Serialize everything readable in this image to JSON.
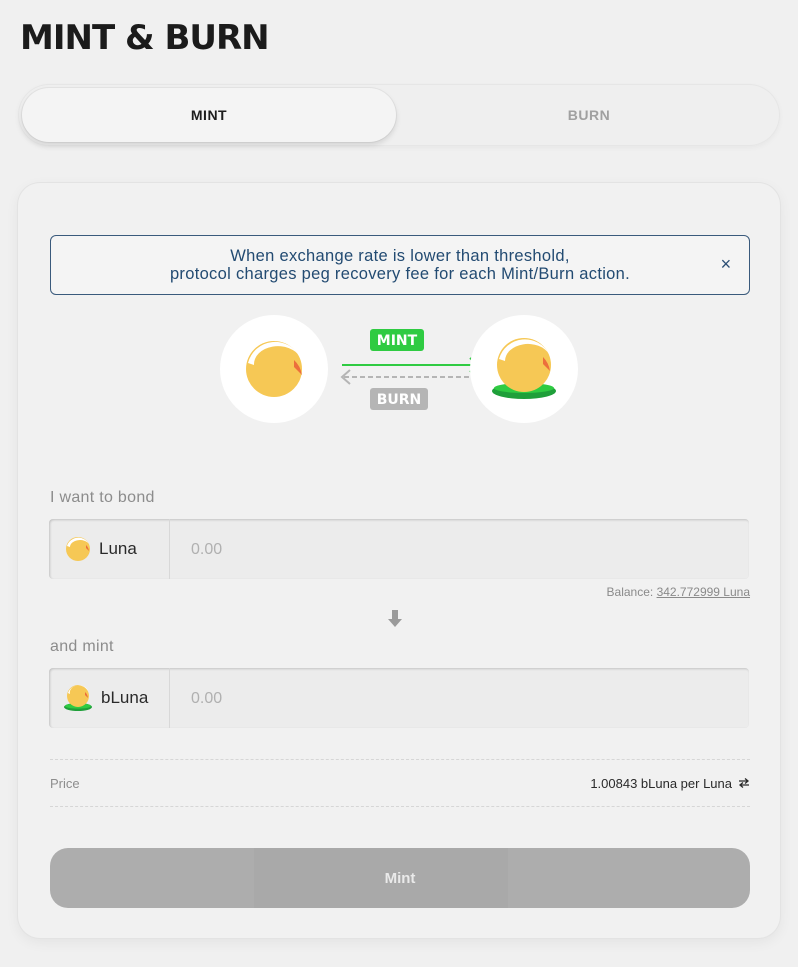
{
  "page": {
    "title": "MINT & BURN"
  },
  "tabs": [
    {
      "label": "MINT",
      "active": true
    },
    {
      "label": "BURN",
      "active": false
    }
  ],
  "notice": {
    "line1": "When exchange rate is lower than threshold,",
    "line2": "protocol charges peg recovery fee for each Mint/Burn action.",
    "close_symbol": "×"
  },
  "diagram": {
    "mint_label": "MINT",
    "burn_label": "BURN"
  },
  "bond": {
    "label": "I want to bond",
    "token": "Luna",
    "placeholder": "0.00",
    "balance_label": "Balance:",
    "balance_value": "342.772999 Luna"
  },
  "mint": {
    "label": "and mint",
    "token": "bLuna",
    "placeholder": "0.00"
  },
  "price": {
    "label": "Price",
    "value": "1.00843 bLuna per Luna"
  },
  "action": {
    "button_label": "Mint"
  },
  "colors": {
    "luna_gold": "#f6c855",
    "luna_orange": "#ec6f3c",
    "bluna_green": "#1f9f3a",
    "mint_green": "#2fcb42",
    "burn_gray": "#b5b5b5",
    "notice_blue": "#234b72"
  }
}
